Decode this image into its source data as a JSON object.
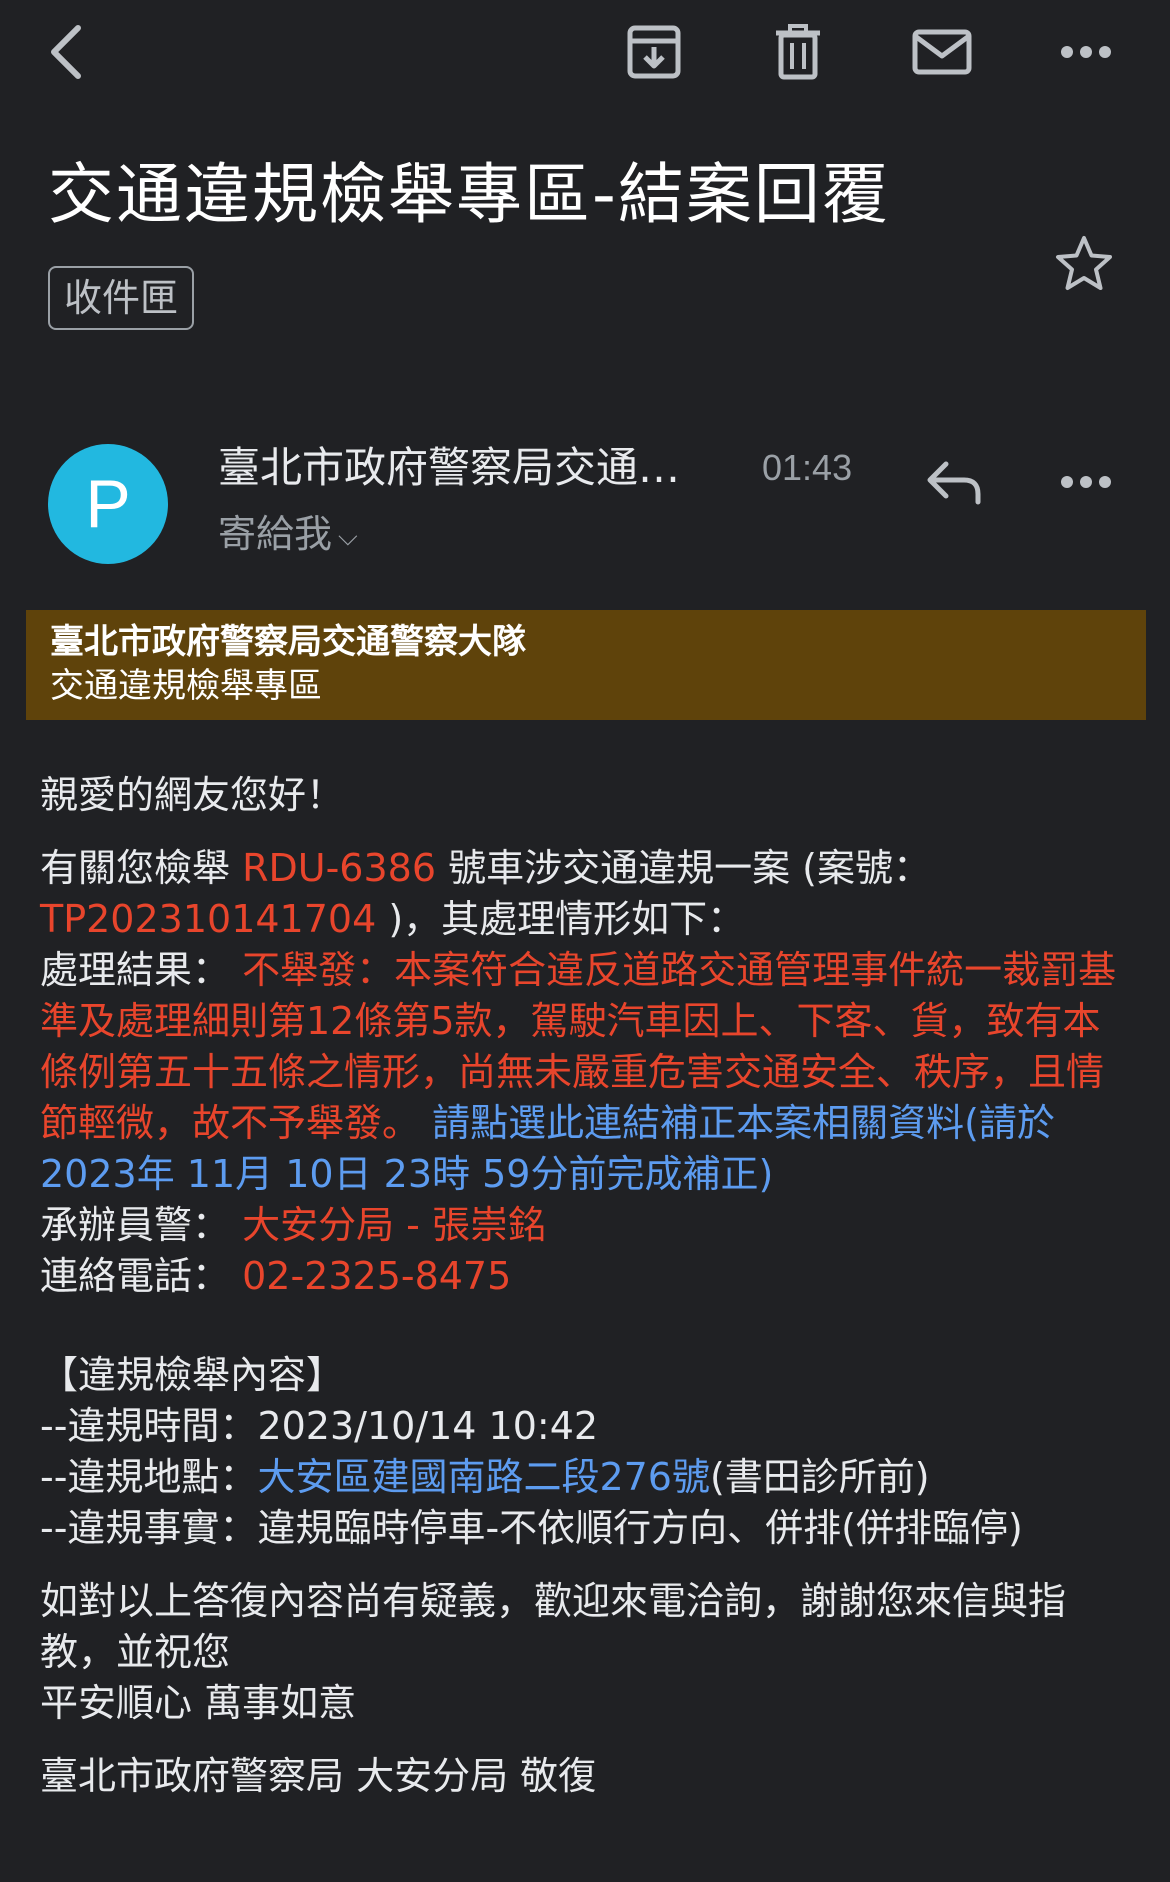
{
  "toolbar": {
    "back_icon": "back-arrow-icon",
    "archive_icon": "archive-icon",
    "delete_icon": "trash-icon",
    "mark_unread_icon": "mail-icon",
    "more_icon": "more-horizontal-icon"
  },
  "email": {
    "subject": "交通違規檢舉專區-結案回覆",
    "label": "收件匣",
    "sender_initial": "P",
    "sender_name": "臺北市政府警察局交通…",
    "time": "01:43",
    "to_line": "寄給我",
    "avatar_color": "#22b8e0"
  },
  "banner": {
    "line1": "臺北市政府警察局交通警察大隊",
    "line2": "交通違規檢舉專區",
    "color": "#5f430b"
  },
  "body": {
    "greeting": "親愛的網友您好！",
    "intro_1": "有關您檢舉 ",
    "plate": "RDU-6386",
    "intro_2": " 號車涉交通違規一案 (案號：",
    "case_no": "TP202310141704",
    "intro_3": " )，其處理情形如下：",
    "result_label": "處理結果： ",
    "result_text": "不舉發：本案符合違反道路交通管理事件統一裁罰基準及處理細則第12條第5款，駕駛汽車因上、下客、貨，致有本條例第五十五條之情形，尚無未嚴重危害交通安全、秩序，且情節輕微，故不予舉發。",
    "link_text": " 請點選此連結補正本案相關資料(請於2023年 11月 10日 23時 59分前完成補正)",
    "officer_label": "承辦員警： ",
    "officer": "大安分局 - 張崇銘",
    "phone_label": "連絡電話： ",
    "phone": "02-2325-8475",
    "section_title": "【違規檢舉內容】",
    "time_label": "--違規時間：",
    "violation_time": "2023/10/14 10:42",
    "place_label": "--違規地點：",
    "place_link": "大安區建國南路二段276號",
    "place_extra": "(書田診所前)",
    "fact_label": "--違規事實：",
    "fact": "違規臨時停車-不依順行方向、併排(併排臨停)",
    "closing_1": "如對以上答復內容尚有疑義，歡迎來電洽詢，謝謝您來信與指教，並祝您",
    "closing_2": "平安順心 萬事如意",
    "signature": "臺北市政府警察局 大安分局 敬復"
  },
  "colors": {
    "background": "#202124",
    "highlight_red": "#e8452c",
    "link_blue": "#5d9cf0"
  }
}
